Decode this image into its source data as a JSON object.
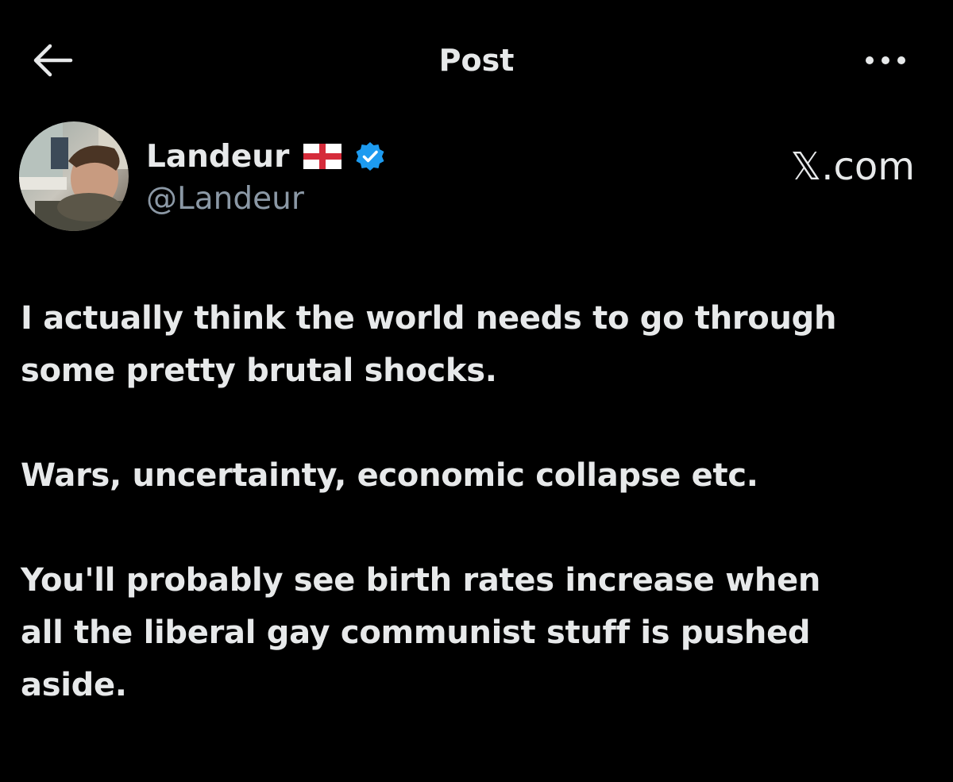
{
  "header": {
    "title": "Post"
  },
  "author": {
    "display_name": "Landeur",
    "flag": "🏴",
    "handle": "@Landeur",
    "verified": true
  },
  "watermark": "𝕏.com",
  "post": {
    "paragraphs": [
      [
        "I actually think the world needs to go through",
        "some pretty brutal shocks."
      ],
      [
        "Wars, uncertainty, economic collapse etc."
      ],
      [
        "You'll probably see birth rates increase when",
        "all the liberal gay communist stuff is pushed",
        "aside."
      ]
    ]
  },
  "colors": {
    "background": "#000000",
    "text": "#e7e9ea",
    "secondary": "#8b98a5",
    "verified": "#1d9bf0"
  },
  "icons": {
    "back": "arrow-left-icon",
    "more": "more-horizontal-icon",
    "verified": "verified-badge-icon",
    "flag": "england-flag-icon"
  }
}
